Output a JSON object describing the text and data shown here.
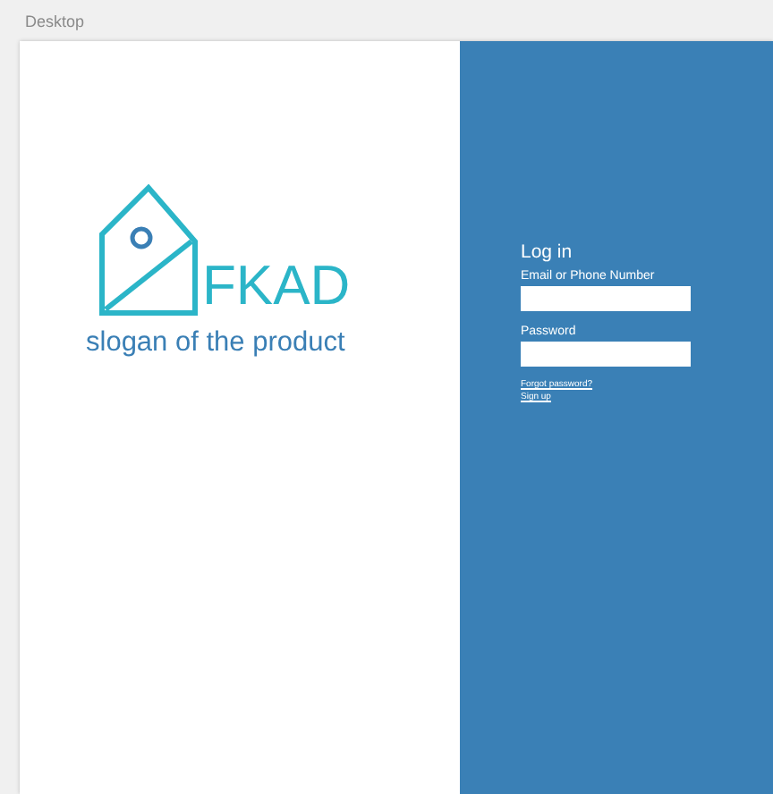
{
  "window": {
    "title": "Desktop"
  },
  "brand": {
    "name": "FKAD",
    "slogan": "slogan of the product"
  },
  "login": {
    "title": "Log in",
    "fields": [
      {
        "label": "Email or Phone Number"
      },
      {
        "label": "Password"
      }
    ],
    "links": [
      "Forgot password?",
      "Sign up"
    ]
  }
}
